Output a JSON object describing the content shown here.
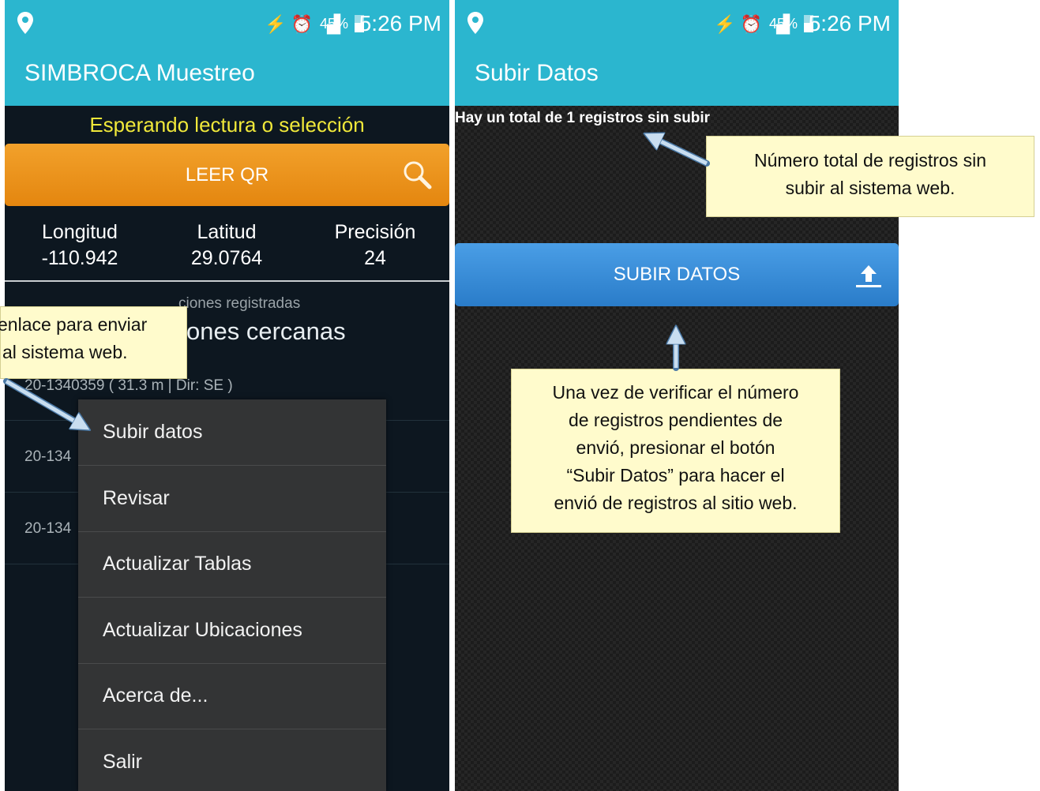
{
  "status_bar": {
    "battery": "45%",
    "time": "5:26 PM"
  },
  "left_screen": {
    "app_title": "SIMBROCA Muestreo",
    "waiting_text": "Esperando lectura o selección",
    "qr_button": "LEER QR",
    "coords": [
      {
        "label": "Longitud",
        "value": "-110.942"
      },
      {
        "label": "Latitud",
        "value": "29.0764"
      },
      {
        "label": "Precisión",
        "value": "24"
      }
    ],
    "section_sub": "ciones registradas",
    "section_title": "ones cercanas",
    "rows": [
      "20-1340359 ( 31.3 m | Dir: SE )",
      "20-134",
      "20-134"
    ],
    "menu": [
      "Subir datos",
      "Revisar",
      "Actualizar Tablas",
      "Actualizar Ubicaciones",
      "Acerca de...",
      "Salir"
    ],
    "note_lines": [
      "enlace para enviar",
      "al sistema web."
    ]
  },
  "right_screen": {
    "app_title": "Subir Datos",
    "count_text": "Hay un total de 1 registros sin subir",
    "upload_button": "SUBIR DATOS",
    "note_top_lines": [
      "Número total de registros sin",
      "subir al sistema web."
    ],
    "note_bottom_lines": [
      "Una vez de verificar el número",
      "de registros pendientes de",
      "envió, presionar el botón",
      "“Subir Datos” para hacer el",
      "envió de registros al sitio web."
    ]
  },
  "colors": {
    "app_bar": "#2bb6cf",
    "qr_button": "#ee9a22",
    "upload_button": "#3a8fdc",
    "note_bg": "#fffbcc",
    "waiting_text": "#f0e83a"
  }
}
